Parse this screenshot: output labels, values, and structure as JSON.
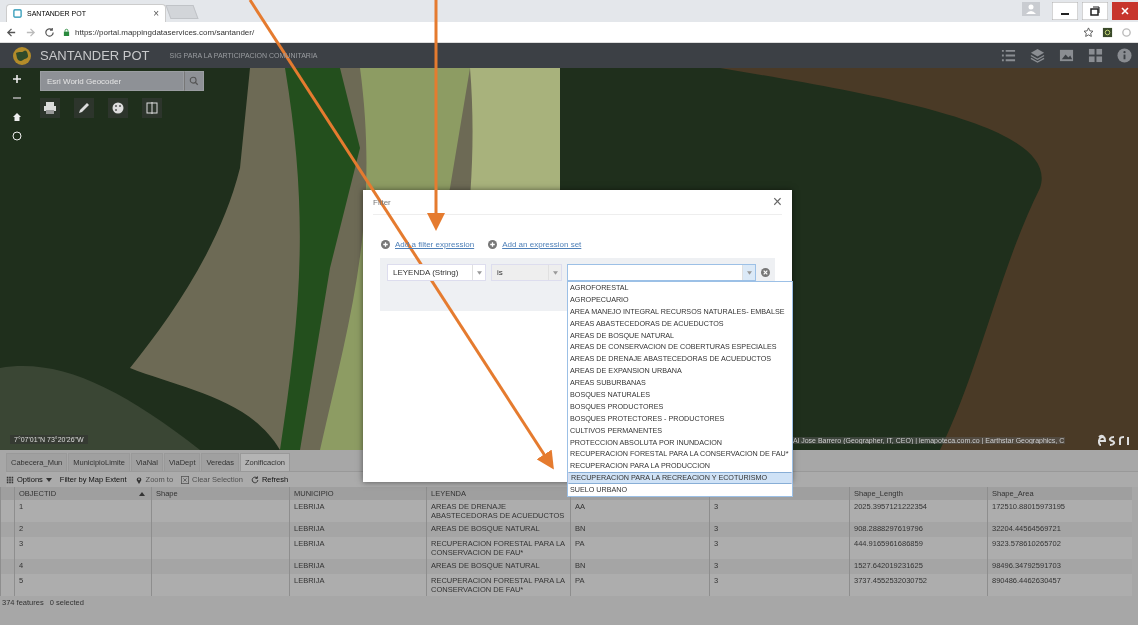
{
  "browser": {
    "tab": {
      "title": "SANTANDER POT",
      "close": "×"
    },
    "url": "https://portal.mappingdataservices.com/santander/"
  },
  "app": {
    "title": "SANTANDER POT",
    "subtitle": "SIG PARA LA PARTICIPACION COMUNITARIA"
  },
  "map": {
    "geocoder": {
      "placeholder": "Esri World Geocoder"
    },
    "coordinates": "7°07'01\"N 73°20'26\"W",
    "attribution": "Al Jose Barrero (Geographer, IT, CEO) | lemapoteca.com.co | Earthstar Geographics, C"
  },
  "dialog": {
    "title": "Filter",
    "close": "×",
    "links": [
      "Add a filter expression",
      "Add an expression set"
    ],
    "field": "LEYENDA (String)",
    "operator": "is",
    "dropdown_open": true,
    "options": [
      {
        "label": "AGROFORESTAL",
        "selected": false
      },
      {
        "label": "AGROPECUARIO",
        "selected": false
      },
      {
        "label": "AREA MANEJO INTEGRAL RECURSOS NATURALES- EMBALSE",
        "selected": false
      },
      {
        "label": "AREAS ABASTECEDORAS DE ACUEDUCTOS",
        "selected": false
      },
      {
        "label": "AREAS DE BOSQUE NATURAL",
        "selected": false
      },
      {
        "label": "AREAS DE CONSERVACION DE COBERTURAS ESPECIALES",
        "selected": false
      },
      {
        "label": "AREAS DE DRENAJE ABASTECEDORAS DE ACUEDUCTOS",
        "selected": false
      },
      {
        "label": "AREAS DE EXPANSION URBANA",
        "selected": false
      },
      {
        "label": "AREAS SUBURBANAS",
        "selected": false
      },
      {
        "label": "BOSQUES NATURALES",
        "selected": false
      },
      {
        "label": "BOSQUES PRODUCTORES",
        "selected": false
      },
      {
        "label": "BOSQUES PROTECTORES - PRODUCTORES",
        "selected": false
      },
      {
        "label": "CULTIVOS PERMANENTES",
        "selected": false
      },
      {
        "label": "PROTECCION ABSOLUTA POR INUNDACION",
        "selected": false
      },
      {
        "label": "RECUPERACION FORESTAL PARA LA CONSERVACION DE FAU*",
        "selected": false
      },
      {
        "label": "RECUPERACION PARA LA PRODUCCION",
        "selected": false
      },
      {
        "label": "RECUPERACION PARA LA RECREACION Y ECOTURISMO",
        "selected": true
      },
      {
        "label": "SUELO URBANO",
        "selected": false
      }
    ]
  },
  "layer_tabs": [
    {
      "label": "Cabecera_Mun",
      "selected": false
    },
    {
      "label": "MunicipioLimite",
      "selected": false
    },
    {
      "label": "ViaNal",
      "selected": false
    },
    {
      "label": "ViaDept",
      "selected": false
    },
    {
      "label": "Veredas",
      "selected": false
    },
    {
      "label": "Zonificacion",
      "selected": true
    }
  ],
  "toolbar": [
    {
      "label": "Options",
      "kind": "menu",
      "disabled": false
    },
    {
      "label": "Filter by Map Extent",
      "kind": "plain",
      "disabled": false
    },
    {
      "label": "Zoom to",
      "kind": "pin",
      "disabled": true
    },
    {
      "label": "Clear Selection",
      "kind": "clear",
      "disabled": true
    },
    {
      "label": "Refresh",
      "kind": "refresh",
      "disabled": false
    }
  ],
  "table": {
    "columns": [
      {
        "label": "OBJECTID",
        "sorted": true
      },
      {
        "label": "Shape"
      },
      {
        "label": "MUNICIPIO"
      },
      {
        "label": "LEYENDA"
      },
      null,
      null,
      {
        "label": "Shape_Length"
      },
      {
        "label": "Shape_Area"
      }
    ],
    "rows": [
      [
        "1",
        null,
        "LEBRIJA",
        "AREAS DE DRENAJE ABASTECEDORAS DE ACUEDUCTOS",
        "AA",
        "3",
        "2025.3957121222354",
        "172510.88015973195"
      ],
      [
        "2",
        null,
        "LEBRIJA",
        "AREAS DE BOSQUE NATURAL",
        "BN",
        "3",
        "908.2888297619796",
        "32204.44564569721"
      ],
      [
        "3",
        null,
        "LEBRIJA",
        "RECUPERACION FORESTAL PARA LA CONSERVACION DE FAU*",
        "PA",
        "3",
        "444.9165961686859",
        "9323.578610265702"
      ],
      [
        "4",
        null,
        "LEBRIJA",
        "AREAS DE BOSQUE NATURAL",
        "BN",
        "3",
        "1527.642019231625",
        "98496.34792591703"
      ],
      [
        "5",
        null,
        "LEBRIJA",
        "RECUPERACION FORESTAL PARA LA CONSERVACION DE FAU*",
        "PA",
        "3",
        "3737.4552532030752",
        "890486.4462630457"
      ]
    ]
  },
  "status": {
    "features": "374 features",
    "selected": "0 selected"
  }
}
